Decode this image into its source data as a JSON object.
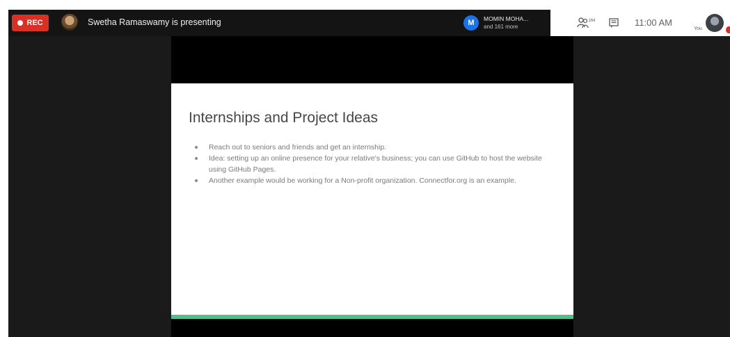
{
  "topbar": {
    "rec_label": "REC",
    "presenter_text": "Swetha Ramaswamy is presenting",
    "participant_initial": "M",
    "participant_name": "MOMIN MOHA...",
    "participant_more": "and 161 more"
  },
  "controls": {
    "people_count": "164",
    "clock": "11:00 AM",
    "you_label": "You"
  },
  "slide": {
    "title": "Internships and Project Ideas",
    "bullets": [
      "Reach out to seniors and friends and get an internship.",
      "Idea: setting up an online presence for your relative's business; you can use GitHub to host the website using GitHub Pages.",
      "Another example would be working for a Non-profit organization. Connectfor.org is an example."
    ]
  },
  "colors": {
    "rec": "#d93025",
    "participant_avatar": "#1a73e8",
    "slide_accent": "#57bb8a"
  },
  "icons": [
    "record-dot-icon",
    "people-icon",
    "chat-icon"
  ]
}
